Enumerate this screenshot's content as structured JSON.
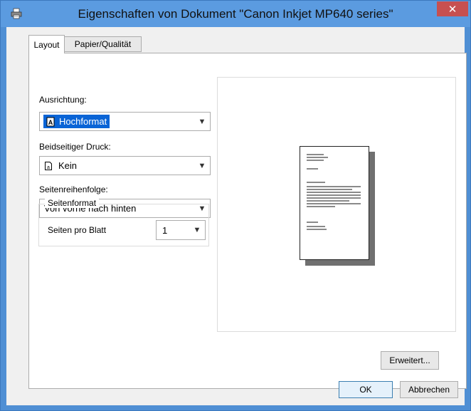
{
  "window": {
    "title": "Eigenschaften von Dokument \"Canon Inkjet MP640 series\"",
    "close_glyph": "✕",
    "icon": "printer-icon"
  },
  "tabs": [
    {
      "label": "Layout",
      "active": true
    },
    {
      "label": "Papier/Qualität",
      "active": false
    }
  ],
  "layout": {
    "orientation": {
      "label": "Ausrichtung:",
      "value": "Hochformat",
      "icon": "portrait-page-icon"
    },
    "duplex": {
      "label": "Beidseitiger Druck:",
      "value": "Kein",
      "icon": "single-page-icon"
    },
    "page_order": {
      "label": "Seitenreihenfolge:",
      "value": "Von vorne nach hinten"
    },
    "page_format": {
      "legend": "Seitenformat",
      "pages_per_sheet_label": "Seiten pro Blatt",
      "pages_per_sheet_value": "1"
    }
  },
  "buttons": {
    "advanced": "Erweitert...",
    "ok": "OK",
    "cancel": "Abbrechen"
  },
  "colors": {
    "title_bar": "#5b9be0",
    "close_button": "#c75050",
    "selection": "#0a64d6"
  }
}
